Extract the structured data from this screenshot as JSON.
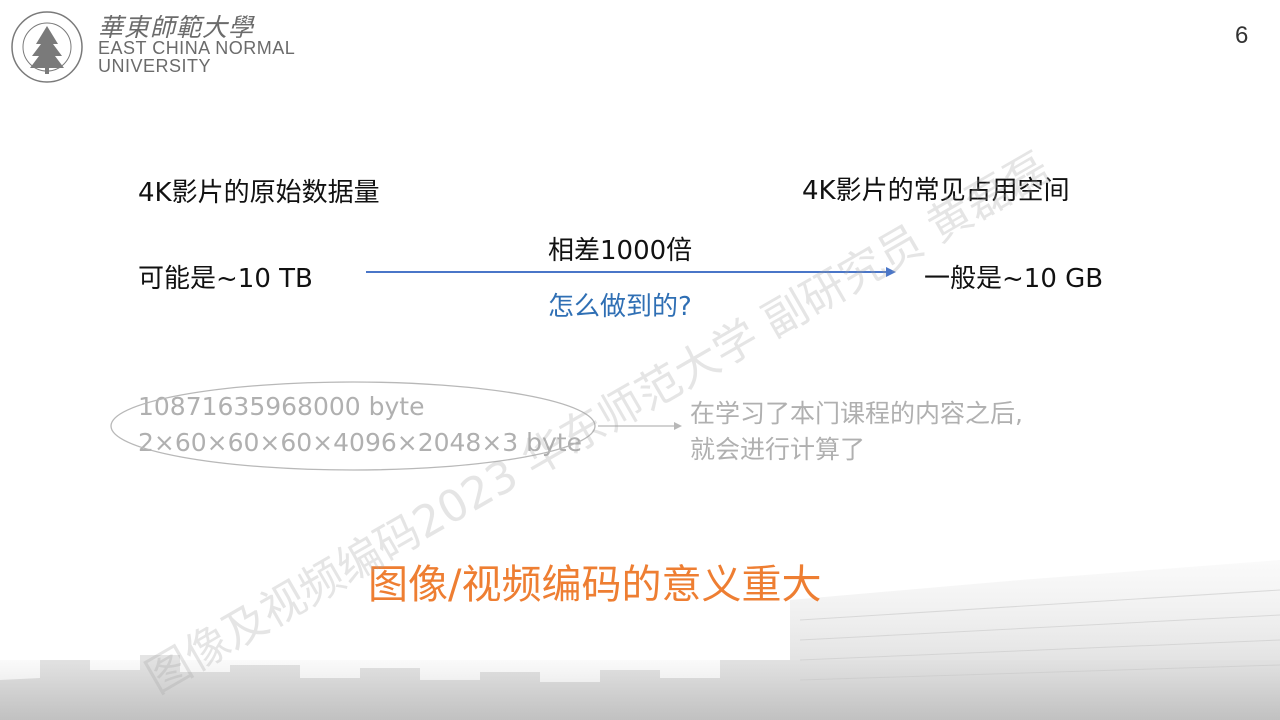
{
  "header": {
    "logo_cn": "華東師範大學",
    "logo_en_line1": "EAST CHINA NORMAL",
    "logo_en_line2": "UNIVERSITY",
    "page_number": "6"
  },
  "slide": {
    "left_title": "4K影片的原始数据量",
    "left_value": "可能是~10 TB",
    "right_title": "4K影片的常见占用空间",
    "right_value": "一般是~10 GB",
    "arrow_top_label": "相差1000倍",
    "arrow_bottom_label": "怎么做到的?",
    "calc_line1": "10871635968000 byte",
    "calc_line2": "2×60×60×60×4096×2048×3 byte",
    "note_line1": "在学习了本门课程的内容之后,",
    "note_line2": "就会进行计算了",
    "conclusion": "图像/视频编码的意义重大"
  },
  "watermark": {
    "text": "图像及视频编码2023 华东师范大学 副研究员 黄磊磊"
  },
  "colors": {
    "accent_blue": "#2f6fb4",
    "arrow_blue": "#4a76c8",
    "conclusion_orange": "#ee7e32",
    "muted_grey": "#b0b0b0"
  }
}
